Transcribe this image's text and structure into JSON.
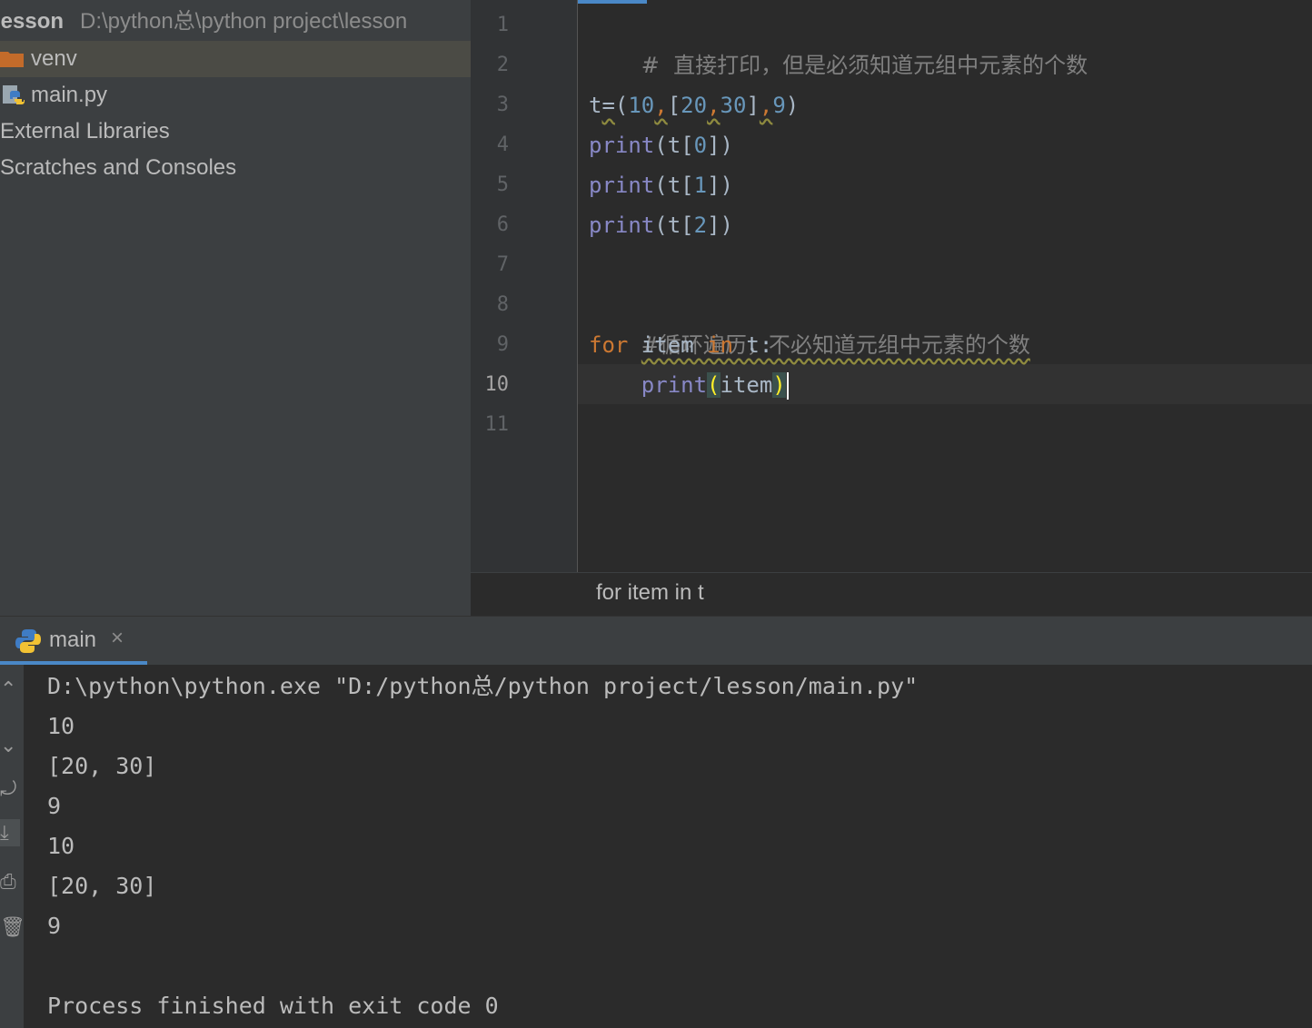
{
  "project": {
    "root_name": "lesson",
    "root_path": "D:\\python总\\python project\\lesson",
    "items": [
      {
        "label": "venv"
      },
      {
        "label": "main.py"
      },
      {
        "label": "External Libraries"
      },
      {
        "label": "Scratches and Consoles"
      }
    ]
  },
  "editor": {
    "line_numbers": [
      "1",
      "2",
      "3",
      "4",
      "5",
      "6",
      "7",
      "8",
      "9",
      "10",
      "11"
    ],
    "current_line": 10,
    "lines": {
      "l1_comment": "#  直接打印，但是必须知道元组中元素的个数",
      "l3": {
        "t": "t",
        "eq": "=",
        "open": "(",
        "n1": "10",
        "c1": ",",
        "lb": "[",
        "n2": "20",
        "c2": ",",
        "n3": "30",
        "rb": "]",
        "c3": ",",
        "n4": "9",
        "close": ")"
      },
      "l4": {
        "fn": "print",
        "a": "(t[",
        "n": "0",
        "b": "])"
      },
      "l5": {
        "fn": "print",
        "a": "(t[",
        "n": "1",
        "b": "])"
      },
      "l6": {
        "fn": "print",
        "a": "(t[",
        "n": "2",
        "b": "])"
      },
      "l8_comment": "#循环遍历，不必知道元组中元素的个数",
      "l9": {
        "kw_for": "for",
        "var": " item ",
        "kw_in": "in",
        "rest": " t:"
      },
      "l10": {
        "indent": "    ",
        "fn": "print",
        "open": "(",
        "arg": "item",
        "close": ")"
      }
    },
    "breadcrumb": "for item in t"
  },
  "run": {
    "tab_label": "main",
    "close_symbol": "×",
    "console_lines": [
      "D:\\python\\python.exe \"D:/python总/python project/lesson/main.py\"",
      "10",
      "[20, 30]",
      "9",
      "10",
      "[20, 30]",
      "9",
      "",
      "Process finished with exit code 0"
    ]
  },
  "colors": {
    "keyword": "#cc7832",
    "function": "#8888c6",
    "number": "#6897bb",
    "comment": "#808080",
    "accent": "#4a88c7"
  }
}
